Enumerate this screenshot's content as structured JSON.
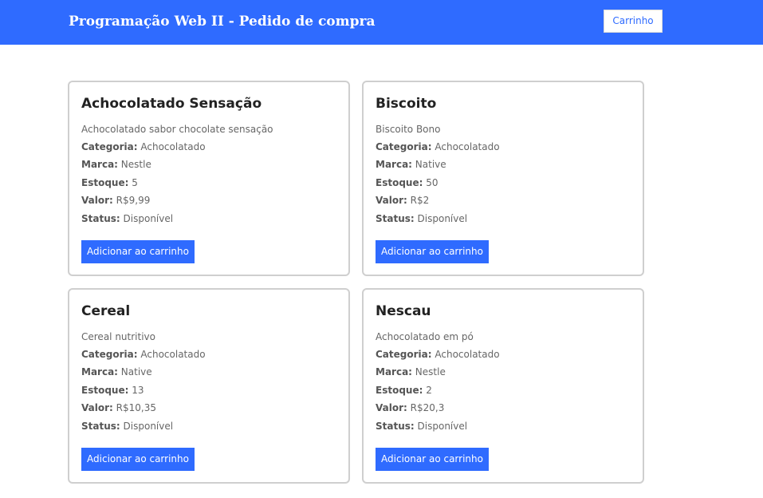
{
  "header": {
    "title": "Programação Web II - Pedido de compra",
    "cart_label": "Carrinho"
  },
  "labels": {
    "category": "Categoria:",
    "brand": "Marca:",
    "stock": "Estoque:",
    "value": "Valor:",
    "status": "Status:"
  },
  "products": [
    {
      "name": "Achocolatado Sensação",
      "description": "Achocolatado sabor chocolate sensação",
      "category": "Achocolatado",
      "brand": "Nestle",
      "stock": "5",
      "value": "R$9,99",
      "status": "Disponível",
      "button_label": "Adicionar ao carrinho"
    },
    {
      "name": "Biscoito",
      "description": "Biscoito Bono",
      "category": "Achocolatado",
      "brand": "Native",
      "stock": "50",
      "value": "R$2",
      "status": "Disponível",
      "button_label": "Adicionar ao carrinho"
    },
    {
      "name": "Cereal",
      "description": "Cereal nutritivo",
      "category": "Achocolatado",
      "brand": "Native",
      "stock": "13",
      "value": "R$10,35",
      "status": "Disponível",
      "button_label": "Adicionar ao carrinho"
    },
    {
      "name": "Nescau",
      "description": "Achocolatado em pó",
      "category": "Achocolatado",
      "brand": "Nestle",
      "stock": "2",
      "value": "R$20,3",
      "status": "Disponível",
      "button_label": "Adicionar ao carrinho"
    }
  ],
  "colors": {
    "accent": "#2f6bff",
    "card_border": "#cfcfcf",
    "title_text": "#222222",
    "body_text": "#666666"
  }
}
